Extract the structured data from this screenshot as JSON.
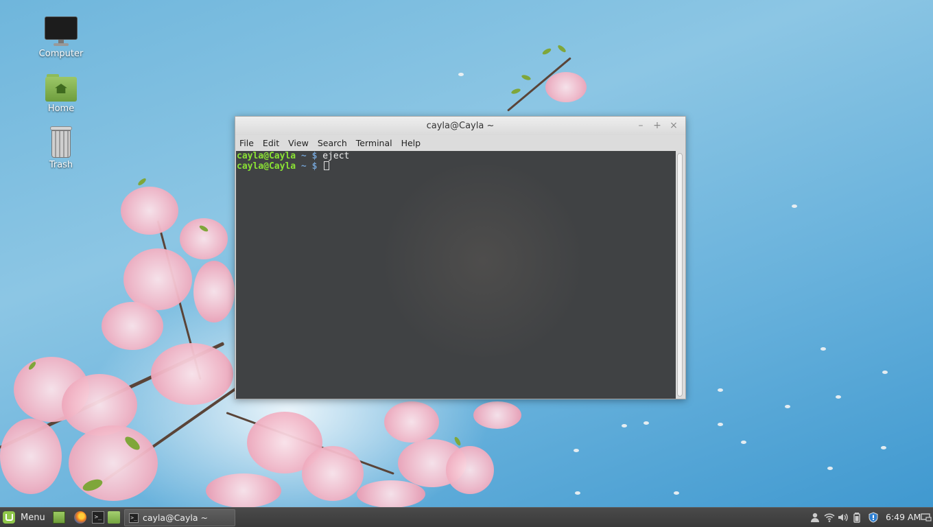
{
  "desktop": {
    "icons": [
      {
        "label": "Computer",
        "icon": "computer-icon"
      },
      {
        "label": "Home",
        "icon": "home-folder-icon"
      },
      {
        "label": "Trash",
        "icon": "trash-icon"
      }
    ]
  },
  "terminal_window": {
    "title": "cayla@Cayla ~",
    "controls": {
      "minimize": "–",
      "maximize": "+",
      "close": "×"
    },
    "menu": [
      "File",
      "Edit",
      "View",
      "Search",
      "Terminal",
      "Help"
    ],
    "lines": [
      {
        "user": "cayla@Cayla",
        "path": " ~ $",
        "command": " eject"
      },
      {
        "user": "cayla@Cayla",
        "path": " ~ $",
        "command": " "
      }
    ],
    "colors": {
      "prompt_user": "#8ae234",
      "prompt_path": "#729fcf"
    }
  },
  "panel": {
    "menu_label": "Menu",
    "launchers": [
      "show-desktop-icon",
      "firefox-icon",
      "terminal-icon",
      "files-icon"
    ],
    "task": {
      "label": "cayla@Cayla ~"
    },
    "tray_icons": [
      "user-icon",
      "wifi-icon",
      "volume-icon",
      "battery-icon",
      "shield-icon",
      "display-icon"
    ],
    "clock": "6:49 AM",
    "term_glyph": ">_"
  }
}
